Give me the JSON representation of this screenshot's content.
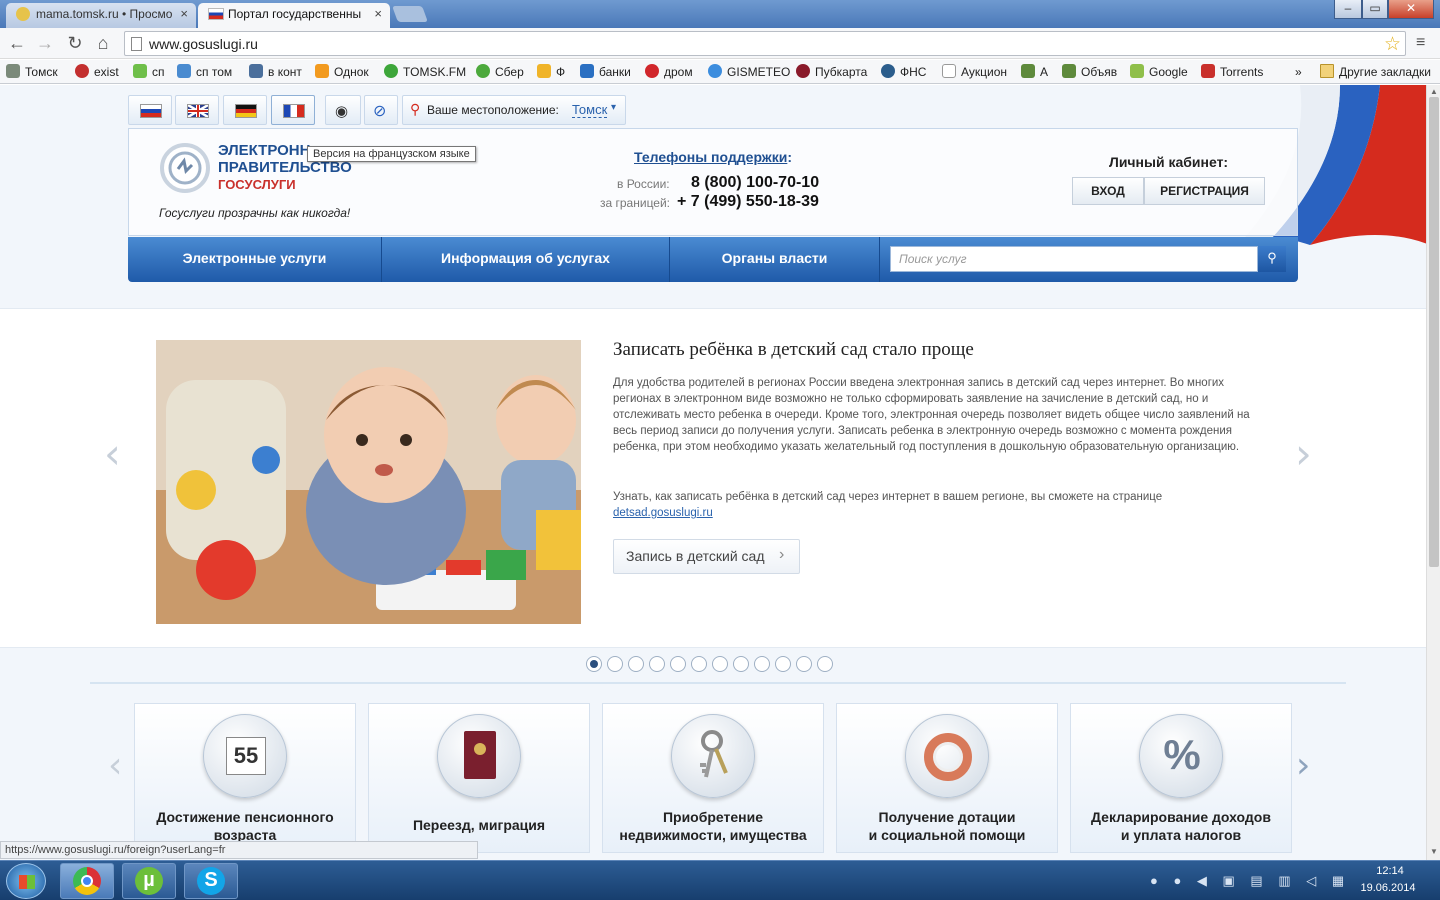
{
  "browser": {
    "tabs": [
      {
        "label": "mama.tomsk.ru • Просмо",
        "close": "×"
      },
      {
        "label": "Портал государственны",
        "close": "×"
      }
    ],
    "window_buttons": [
      "–",
      "▭",
      "✕"
    ],
    "url": "www.gosuslugi.ru",
    "bookmarks": [
      "Томск",
      "exist",
      "сп",
      "сп том",
      "в конт",
      "Однок",
      "TOMSK.FM",
      "Сбер",
      "Ф",
      "банки",
      "дром",
      "GISMETEO",
      "Пубкарта",
      "ФНС",
      "Аукцион",
      "А",
      "Объяв",
      "Google",
      "Torrents"
    ],
    "bookmarks_more": "»",
    "other_bookmarks": "Другие закладки",
    "status_url": "https://www.gosuslugi.ru/foreign?userLang=fr"
  },
  "header": {
    "location_label": "Ваше местоположение:",
    "location_value": "Томск",
    "tooltip": "Версия на французском языке",
    "logo_line1": "ЭЛЕКТРОНН",
    "logo_line2": "ПРАВИТЕЛЬСТВО",
    "logo_line3": "ГОСУСЛУГИ",
    "slogan": "Госуслуги прозрачны как никогда!",
    "support_title": "Телефоны поддержки",
    "support_colon": ":",
    "russia_label": "в России:",
    "russia_phone": "8 (800) 100-70-10",
    "abroad_label": "за границей:",
    "abroad_phone": "+ 7 (499) 550-18-39",
    "cabinet_title": "Личный кабинет:",
    "login": "ВХОД",
    "register": "РЕГИСТРАЦИЯ"
  },
  "nav": {
    "items": [
      "Электронные услуги",
      "Информация об услугах",
      "Органы власти"
    ],
    "search_placeholder": "Поиск услуг"
  },
  "slide": {
    "title": "Записать ребёнка в детский сад стало проще",
    "body": "Для удобства родителей в регионах России введена электронная запись в детский сад через интернет. Во многих регионах в электронном виде возможно не только сформировать заявление на зачисление в детский сад, но и отслеживать место ребенка в очереди. Кроме того, электронная очередь позволяет видеть общее число заявлений на весь период записи до получения услуги. Записать ребенка в электронную очередь возможно с момента рождения ребенка, при этом необходимо указать желательный год поступления в дошкольную образовательную организацию.",
    "note": "Узнать, как записать ребёнка в детский сад через интернет в вашем регионе, вы сможете на странице",
    "link": "detsad.gosuslugi.ru",
    "button": "Запись в детский сад",
    "dots": 12,
    "active_dot": 0
  },
  "categories": [
    {
      "line1": "Достижение пенсионного",
      "line2": "возраста",
      "icon_text": "55"
    },
    {
      "line1": "Переезд, миграция",
      "line2": "",
      "icon_text": ""
    },
    {
      "line1": "Приобретение",
      "line2": "недвижимости, имущества",
      "icon_text": ""
    },
    {
      "line1": "Получение дотации",
      "line2": "и социальной помощи",
      "icon_text": ""
    },
    {
      "line1": "Декларирование доходов",
      "line2": "и уплата налогов",
      "icon_text": "%"
    }
  ],
  "taskbar": {
    "time": "12:14",
    "date": "19.06.2014"
  }
}
